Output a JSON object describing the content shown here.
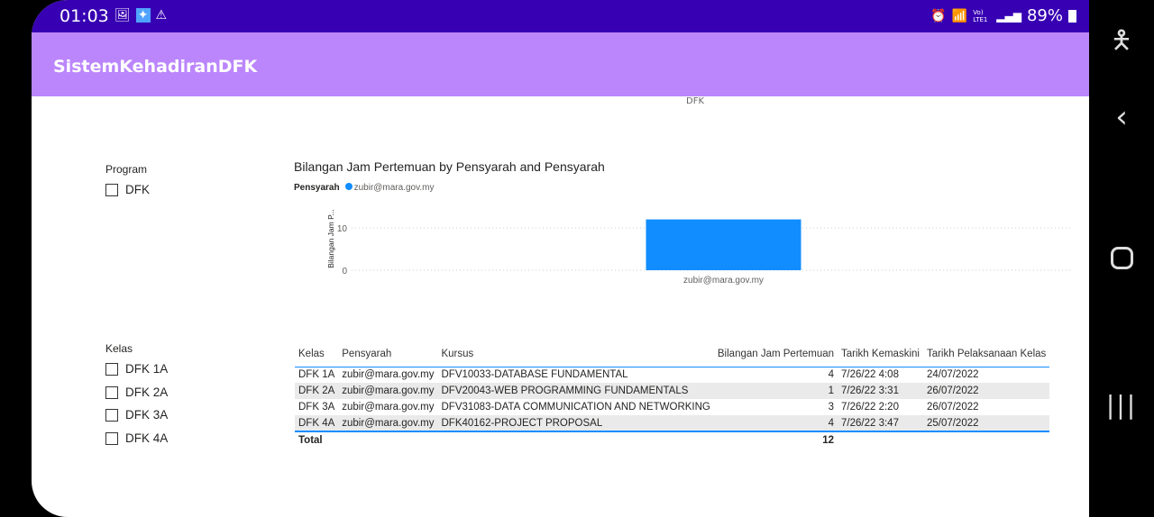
{
  "status_bar": {
    "time": "01:03",
    "battery": "89%",
    "icons": [
      "image-icon",
      "app-icon",
      "warning-icon",
      "alarm-icon",
      "wifi-icon",
      "volte-icon",
      "signal-icon",
      "battery-charging-icon"
    ],
    "volte": "Vo) LTE1"
  },
  "app": {
    "title": "SistemKehadiranDFK"
  },
  "top_axis_label": "DFK",
  "slicers": {
    "program": {
      "title": "Program",
      "items": [
        "DFK"
      ]
    },
    "kelas": {
      "title": "Kelas",
      "items": [
        "DFK 1A",
        "DFK 2A",
        "DFK 3A",
        "DFK 4A"
      ]
    }
  },
  "chart_data": {
    "type": "bar",
    "title": "Bilangan Jam Pertemuan by Pensyarah and Pensyarah",
    "legend_title": "Pensyarah",
    "legend_position": "top-left",
    "categories": [
      "zubir@mara.gov.my"
    ],
    "series": [
      {
        "name": "zubir@mara.gov.my",
        "values": [
          12
        ],
        "color": "#118dff"
      }
    ],
    "ylabel": "Bilangan Jam P...",
    "xlabel": "",
    "yticks": [
      0,
      10
    ],
    "ylim": [
      0,
      15
    ],
    "grid": true
  },
  "table": {
    "headers": [
      "Kelas",
      "Pensyarah",
      "Kursus",
      "Bilangan Jam Pertemuan",
      "Tarikh Kemaskini",
      "Tarikh Pelaksanaan Kelas"
    ],
    "rows": [
      [
        "DFK 1A",
        "zubir@mara.gov.my",
        "DFV10033-DATABASE FUNDAMENTAL",
        "4",
        "7/26/22 4:08",
        "24/07/2022"
      ],
      [
        "DFK 2A",
        "zubir@mara.gov.my",
        "DFV20043-WEB PROGRAMMING FUNDAMENTALS",
        "1",
        "7/26/22 3:31",
        "26/07/2022"
      ],
      [
        "DFK 3A",
        "zubir@mara.gov.my",
        "DFV31083-DATA COMMUNICATION AND NETWORKING",
        "3",
        "7/26/22 2:20",
        "26/07/2022"
      ],
      [
        "DFK 4A",
        "zubir@mara.gov.my",
        "DFK40162-PROJECT PROPOSAL",
        "4",
        "7/26/22 3:47",
        "25/07/2022"
      ]
    ],
    "total_label": "Total",
    "total_value": "12"
  },
  "nav": {
    "icons": [
      "accessibility-icon",
      "back-icon",
      "home-icon",
      "recents-icon"
    ]
  }
}
